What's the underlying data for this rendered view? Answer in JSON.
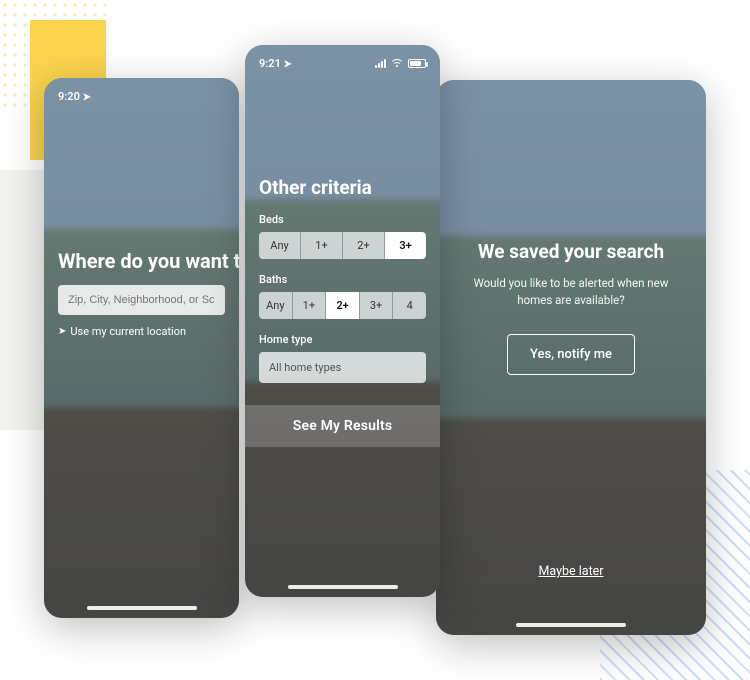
{
  "screen1": {
    "time": "9:20",
    "title": "Where do you want to",
    "search_placeholder": "Zip, City, Neighborhood, or School",
    "use_location": "Use my current location"
  },
  "screen2": {
    "time": "9:21",
    "title": "Other criteria",
    "beds_label": "Beds",
    "beds_options": [
      "Any",
      "1+",
      "2+",
      "3+"
    ],
    "beds_selected": "3+",
    "baths_label": "Baths",
    "baths_options": [
      "Any",
      "1+",
      "2+",
      "3+",
      "4"
    ],
    "baths_selected": "2+",
    "home_type_label": "Home type",
    "home_type_value": "All home types",
    "cta": "See My Results"
  },
  "screen3": {
    "title": "We saved your search",
    "subtitle": "Would you like to be alerted when new homes are available?",
    "primary_btn": "Yes, notify me",
    "secondary_link": "Maybe later"
  }
}
